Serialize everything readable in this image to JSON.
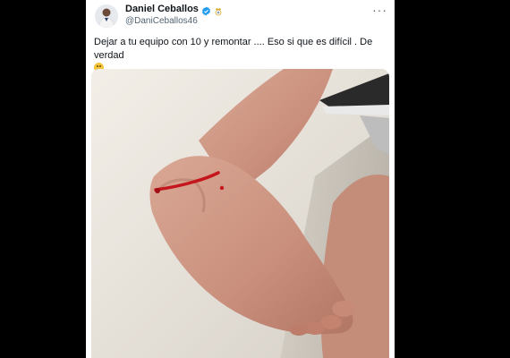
{
  "tweet": {
    "author_name": "Daniel Ceballos",
    "author_handle": "@DaniCeballos46",
    "verified_icon": "verified-badge-icon",
    "club_icon": "real-madrid-crest-icon",
    "more_icon": "more-options-icon",
    "more_label": "···",
    "text": "Dejar a tu equipo con 10 y remontar .... Eso si que es difícil . De verdad",
    "emoji_icon": "thinking-face-emoji",
    "media": {
      "icon": "injured-ankle-photo"
    }
  },
  "colors": {
    "background": "#000000",
    "card": "#ffffff",
    "text": "#0f1419",
    "secondary_text": "#536471",
    "verified": "#1d9bf0"
  }
}
